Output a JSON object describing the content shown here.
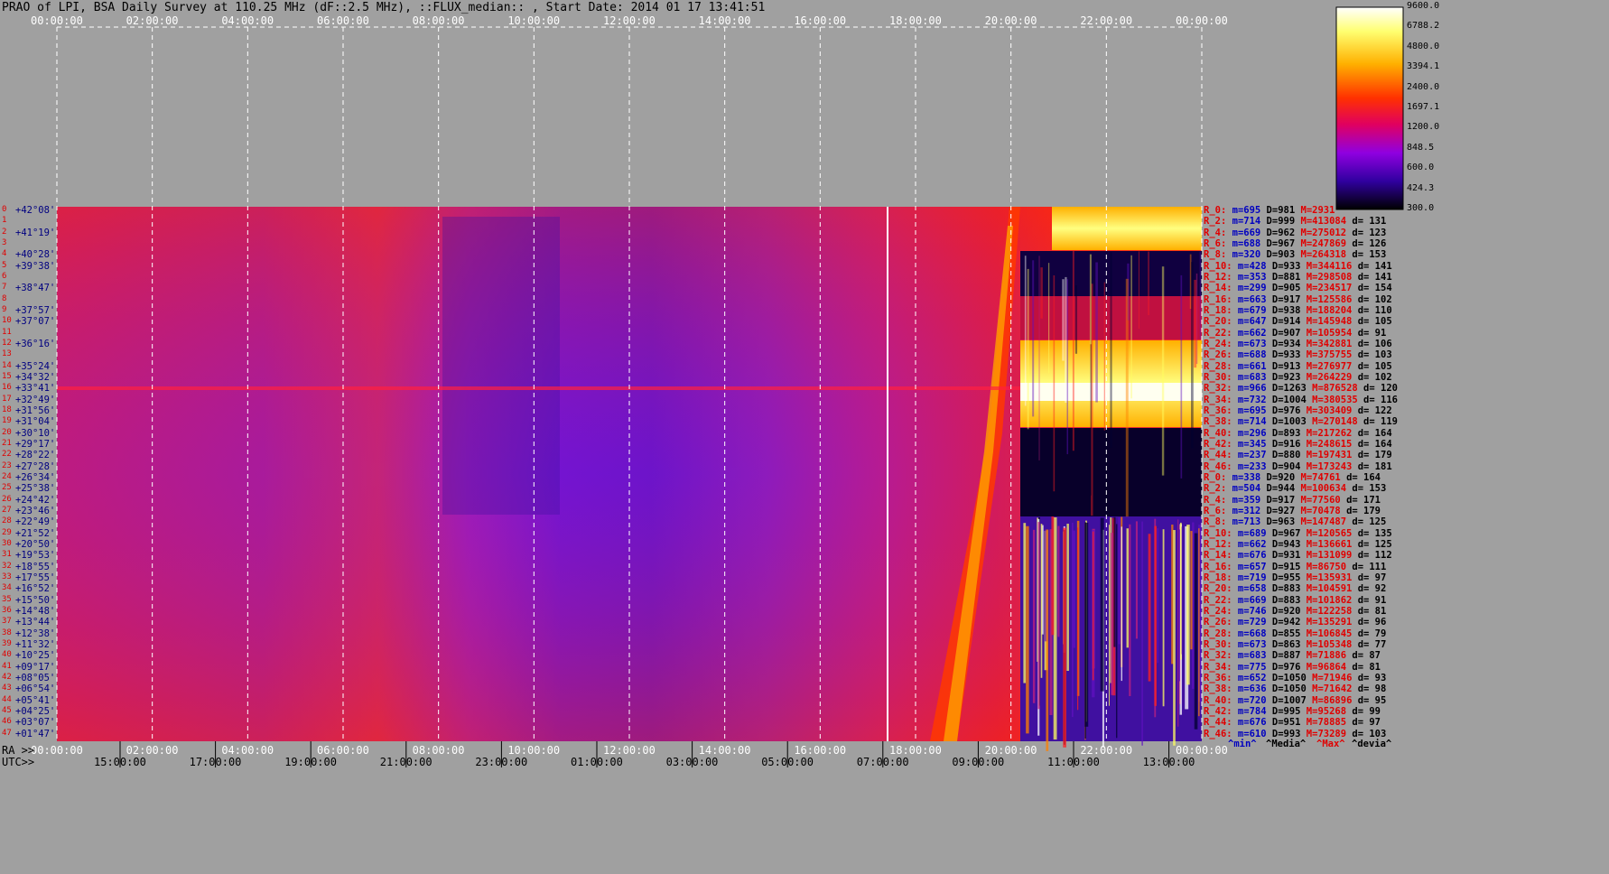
{
  "title": "PRAO of LPI, BSA Daily Survey at 110.25 MHz (dF::2.5 MHz), ::FLUX_median:: , Start Date: 2014 01 17 13:41:51",
  "ra_prefix": "RA >>",
  "utc_prefix": "UTC>>",
  "colors": {
    "background": "#a0a0a0",
    "grid": "#ffffff",
    "label_red": "#e00000",
    "label_blue": "#0000c0"
  },
  "chart_data": {
    "type": "heatmap",
    "title": "PRAO of LPI, BSA Daily Survey at 110.25 MHz (dF::2.5 MHz), ::FLUX_median:: , Start Date: 2014 01 17 13:41:51",
    "top_axis": [
      "00:00:00",
      "02:00:00",
      "04:00:00",
      "06:00:00",
      "08:00:00",
      "10:00:00",
      "12:00:00",
      "14:00:00",
      "16:00:00",
      "18:00:00",
      "20:00:00",
      "22:00:00",
      "00:00:00"
    ],
    "ra_axis": [
      "00:00:00",
      "02:00:00",
      "04:00:00",
      "06:00:00",
      "08:00:00",
      "10:00:00",
      "12:00:00",
      "14:00:00",
      "16:00:00",
      "18:00:00",
      "20:00:00",
      "22:00:00",
      "00:00:00"
    ],
    "utc_axis": [
      "15:00:00",
      "17:00:00",
      "19:00:00",
      "21:00:00",
      "23:00:00",
      "01:00:00",
      "03:00:00",
      "05:00:00",
      "07:00:00",
      "09:00:00",
      "11:00:00",
      "13:00:00"
    ],
    "colorbar_ticks": [
      "9600.0",
      "6788.2",
      "4800.0",
      "3394.1",
      "2400.0",
      "1697.1",
      "1200.0",
      "848.5",
      "600.0",
      "424.3",
      "300.0"
    ],
    "colorbar_range": [
      300.0,
      9600.0
    ],
    "rows": [
      {
        "i": "0",
        "dec": "+42°08'"
      },
      {
        "i": "1",
        "dec": ""
      },
      {
        "i": "2",
        "dec": "+41°19'"
      },
      {
        "i": "3",
        "dec": ""
      },
      {
        "i": "4",
        "dec": "+40°28'"
      },
      {
        "i": "5",
        "dec": "+39°38'"
      },
      {
        "i": "6",
        "dec": ""
      },
      {
        "i": "7",
        "dec": "+38°47'"
      },
      {
        "i": "8",
        "dec": ""
      },
      {
        "i": "9",
        "dec": "+37°57'"
      },
      {
        "i": "10",
        "dec": "+37°07'"
      },
      {
        "i": "11",
        "dec": ""
      },
      {
        "i": "12",
        "dec": "+36°16'"
      },
      {
        "i": "13",
        "dec": ""
      },
      {
        "i": "14",
        "dec": "+35°24'"
      },
      {
        "i": "15",
        "dec": "+34°32'"
      },
      {
        "i": "16",
        "dec": "+33°41'"
      },
      {
        "i": "17",
        "dec": "+32°49'"
      },
      {
        "i": "18",
        "dec": "+31°56'"
      },
      {
        "i": "19",
        "dec": "+31°04'"
      },
      {
        "i": "20",
        "dec": "+30°10'"
      },
      {
        "i": "21",
        "dec": "+29°17'"
      },
      {
        "i": "22",
        "dec": "+28°22'"
      },
      {
        "i": "23",
        "dec": "+27°28'"
      },
      {
        "i": "24",
        "dec": "+26°34'"
      },
      {
        "i": "25",
        "dec": "+25°38'"
      },
      {
        "i": "26",
        "dec": "+24°42'"
      },
      {
        "i": "27",
        "dec": "+23°46'"
      },
      {
        "i": "28",
        "dec": "+22°49'"
      },
      {
        "i": "29",
        "dec": "+21°52'"
      },
      {
        "i": "30",
        "dec": "+20°50'"
      },
      {
        "i": "31",
        "dec": "+19°53'"
      },
      {
        "i": "32",
        "dec": "+18°55'"
      },
      {
        "i": "33",
        "dec": "+17°55'"
      },
      {
        "i": "34",
        "dec": "+16°52'"
      },
      {
        "i": "35",
        "dec": "+15°50'"
      },
      {
        "i": "36",
        "dec": "+14°48'"
      },
      {
        "i": "37",
        "dec": "+13°44'"
      },
      {
        "i": "38",
        "dec": "+12°38'"
      },
      {
        "i": "39",
        "dec": "+11°32'"
      },
      {
        "i": "40",
        "dec": "+10°25'"
      },
      {
        "i": "41",
        "dec": "+09°17'"
      },
      {
        "i": "42",
        "dec": "+08°05'"
      },
      {
        "i": "43",
        "dec": "+06°54'"
      },
      {
        "i": "44",
        "dec": "+05°41'"
      },
      {
        "i": "45",
        "dec": "+04°25'"
      },
      {
        "i": "46",
        "dec": "+03°07'"
      },
      {
        "i": "47",
        "dec": "+01°47'"
      }
    ],
    "stats_footer": [
      "^min^",
      "^Media^",
      "^Max^",
      "^devia^"
    ],
    "stats": [
      {
        "r": "R_0:",
        "m": "m=695",
        "D": "D=981",
        "M": "M=2931",
        "d": ""
      },
      {
        "r": "R_2:",
        "m": "m=714",
        "D": "D=999",
        "M": "M=413084",
        "d": "d= 131"
      },
      {
        "r": "R_4:",
        "m": "m=669",
        "D": "D=962",
        "M": "M=275012",
        "d": "d= 123"
      },
      {
        "r": "R_6:",
        "m": "m=688",
        "D": "D=967",
        "M": "M=247869",
        "d": "d= 126"
      },
      {
        "r": "R_8:",
        "m": "m=320",
        "D": "D=903",
        "M": "M=264318",
        "d": "d= 153"
      },
      {
        "r": "R_10:",
        "m": "m=428",
        "D": "D=933",
        "M": "M=344116",
        "d": "d= 141"
      },
      {
        "r": "R_12:",
        "m": "m=353",
        "D": "D=881",
        "M": "M=298508",
        "d": "d= 141"
      },
      {
        "r": "R_14:",
        "m": "m=299",
        "D": "D=905",
        "M": "M=234517",
        "d": "d= 154"
      },
      {
        "r": "R_16:",
        "m": "m=663",
        "D": "D=917",
        "M": "M=125586",
        "d": "d= 102"
      },
      {
        "r": "R_18:",
        "m": "m=679",
        "D": "D=938",
        "M": "M=188204",
        "d": "d= 110"
      },
      {
        "r": "R_20:",
        "m": "m=647",
        "D": "D=914",
        "M": "M=145948",
        "d": "d= 105"
      },
      {
        "r": "R_22:",
        "m": "m=662",
        "D": "D=907",
        "M": "M=105954",
        "d": "d= 91"
      },
      {
        "r": "R_24:",
        "m": "m=673",
        "D": "D=934",
        "M": "M=342881",
        "d": "d= 106"
      },
      {
        "r": "R_26:",
        "m": "m=688",
        "D": "D=933",
        "M": "M=375755",
        "d": "d= 103"
      },
      {
        "r": "R_28:",
        "m": "m=661",
        "D": "D=913",
        "M": "M=276977",
        "d": "d= 105"
      },
      {
        "r": "R_30:",
        "m": "m=683",
        "D": "D=923",
        "M": "M=264229",
        "d": "d= 102"
      },
      {
        "r": "R_32:",
        "m": "m=966",
        "D": "D=1263",
        "M": "M=876528",
        "d": "d= 120"
      },
      {
        "r": "R_34:",
        "m": "m=732",
        "D": "D=1004",
        "M": "M=380535",
        "d": "d= 116"
      },
      {
        "r": "R_36:",
        "m": "m=695",
        "D": "D=976",
        "M": "M=303409",
        "d": "d= 122"
      },
      {
        "r": "R_38:",
        "m": "m=714",
        "D": "D=1003",
        "M": "M=270148",
        "d": "d= 119"
      },
      {
        "r": "R_40:",
        "m": "m=296",
        "D": "D=893",
        "M": "M=217262",
        "d": "d= 164"
      },
      {
        "r": "R_42:",
        "m": "m=345",
        "D": "D=916",
        "M": "M=248615",
        "d": "d= 164"
      },
      {
        "r": "R_44:",
        "m": "m=237",
        "D": "D=880",
        "M": "M=197431",
        "d": "d= 179"
      },
      {
        "r": "R_46:",
        "m": "m=233",
        "D": "D=904",
        "M": "M=173243",
        "d": "d= 181"
      },
      {
        "r": "R_0:",
        "m": "m=338",
        "D": "D=920",
        "M": "M=74761",
        "d": "d= 164"
      },
      {
        "r": "R_2:",
        "m": "m=504",
        "D": "D=944",
        "M": "M=100634",
        "d": "d= 153"
      },
      {
        "r": "R_4:",
        "m": "m=359",
        "D": "D=917",
        "M": "M=77560",
        "d": "d= 171"
      },
      {
        "r": "R_6:",
        "m": "m=312",
        "D": "D=927",
        "M": "M=70478",
        "d": "d= 179"
      },
      {
        "r": "R_8:",
        "m": "m=713",
        "D": "D=963",
        "M": "M=147487",
        "d": "d= 125"
      },
      {
        "r": "R_10:",
        "m": "m=689",
        "D": "D=967",
        "M": "M=120565",
        "d": "d= 135"
      },
      {
        "r": "R_12:",
        "m": "m=662",
        "D": "D=943",
        "M": "M=136661",
        "d": "d= 125"
      },
      {
        "r": "R_14:",
        "m": "m=676",
        "D": "D=931",
        "M": "M=131099",
        "d": "d= 112"
      },
      {
        "r": "R_16:",
        "m": "m=657",
        "D": "D=915",
        "M": "M=86750",
        "d": "d= 111"
      },
      {
        "r": "R_18:",
        "m": "m=719",
        "D": "D=955",
        "M": "M=135931",
        "d": "d= 97"
      },
      {
        "r": "R_20:",
        "m": "m=658",
        "D": "D=883",
        "M": "M=104591",
        "d": "d= 92"
      },
      {
        "r": "R_22:",
        "m": "m=669",
        "D": "D=883",
        "M": "M=101862",
        "d": "d= 91"
      },
      {
        "r": "R_24:",
        "m": "m=746",
        "D": "D=920",
        "M": "M=122258",
        "d": "d= 81"
      },
      {
        "r": "R_26:",
        "m": "m=729",
        "D": "D=942",
        "M": "M=135291",
        "d": "d= 96"
      },
      {
        "r": "R_28:",
        "m": "m=668",
        "D": "D=855",
        "M": "M=106845",
        "d": "d= 79"
      },
      {
        "r": "R_30:",
        "m": "m=673",
        "D": "D=863",
        "M": "M=105348",
        "d": "d= 77"
      },
      {
        "r": "R_32:",
        "m": "m=683",
        "D": "D=887",
        "M": "M=71886",
        "d": "d= 87"
      },
      {
        "r": "R_34:",
        "m": "m=775",
        "D": "D=976",
        "M": "M=96864",
        "d": "d= 81"
      },
      {
        "r": "R_36:",
        "m": "m=652",
        "D": "D=1050",
        "M": "M=71946",
        "d": "d= 93"
      },
      {
        "r": "R_38:",
        "m": "m=636",
        "D": "D=1050",
        "M": "M=71642",
        "d": "d= 98"
      },
      {
        "r": "R_40:",
        "m": "m=720",
        "D": "D=1007",
        "M": "M=86896",
        "d": "d= 95"
      },
      {
        "r": "R_42:",
        "m": "m=784",
        "D": "D=995",
        "M": "M=95268",
        "d": "d= 99"
      },
      {
        "r": "R_44:",
        "m": "m=676",
        "D": "D=951",
        "M": "M=78885",
        "d": "d= 97"
      },
      {
        "r": "R_46:",
        "m": "m=610",
        "D": "D=993",
        "M": "M=73289",
        "d": "d= 103"
      }
    ]
  }
}
